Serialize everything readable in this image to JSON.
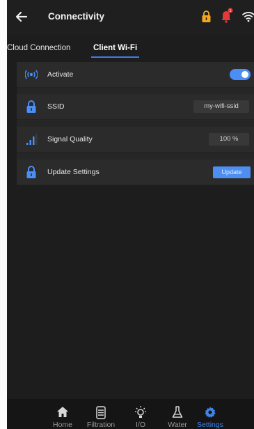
{
  "header": {
    "title": "Connectivity",
    "notification_count": "1"
  },
  "tabs": [
    {
      "label": "Cloud Connection",
      "active": false
    },
    {
      "label": "Client Wi-Fi",
      "active": true
    }
  ],
  "settings": {
    "activate": {
      "label": "Activate",
      "enabled": true
    },
    "ssid": {
      "label": "SSID",
      "value": "my-wifi-ssid"
    },
    "signal": {
      "label": "Signal Quality",
      "value": "100 %"
    },
    "update": {
      "label": "Update Settings",
      "button": "Update"
    }
  },
  "nav": [
    {
      "label": "Home",
      "icon": "home-icon"
    },
    {
      "label": "Filtration",
      "icon": "filtration-icon"
    },
    {
      "label": "I/O",
      "icon": "lightbulb-icon"
    },
    {
      "label": "Water",
      "icon": "flask-icon"
    },
    {
      "label": "Settings",
      "icon": "gear-icon",
      "active": true
    }
  ],
  "colors": {
    "accent": "#4b8ef5",
    "lock": "#f3a623",
    "bell": "#e23a3a",
    "background": "#1d1d1d"
  }
}
